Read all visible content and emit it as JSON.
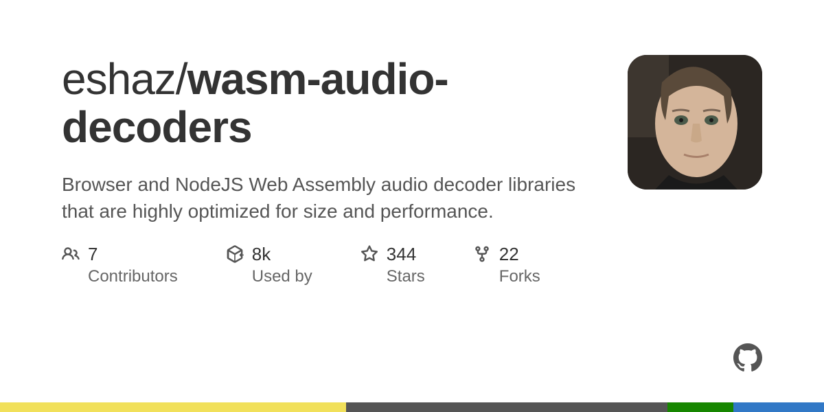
{
  "repo": {
    "owner": "eshaz",
    "name": "wasm-audio-decoders",
    "description": "Browser and NodeJS Web Assembly audio decoder libraries that are highly optimized for size and performance."
  },
  "stats": {
    "contributors": {
      "value": "7",
      "label": "Contributors"
    },
    "usedby": {
      "value": "8k",
      "label": "Used by"
    },
    "stars": {
      "value": "344",
      "label": "Stars"
    },
    "forks": {
      "value": "22",
      "label": "Forks"
    }
  },
  "languages": [
    {
      "color": "#f1e05a",
      "width": "42%"
    },
    {
      "color": "#555555",
      "width": "39%"
    },
    {
      "color": "#178600",
      "width": "8%"
    },
    {
      "color": "#3178c6",
      "width": "11%"
    }
  ]
}
